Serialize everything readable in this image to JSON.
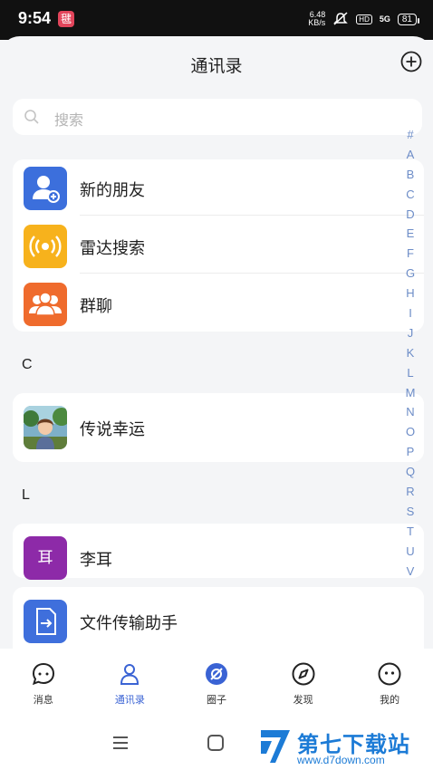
{
  "status_bar": {
    "time": "9:54",
    "app_badge": "毽",
    "net_speed_value": "6.48",
    "net_speed_unit": "KB/s",
    "signal_label": "5G",
    "hd_label": "HD",
    "battery": "81"
  },
  "header": {
    "title": "通讯录"
  },
  "search": {
    "placeholder": "搜索"
  },
  "top_items": [
    {
      "label": "新的朋友",
      "color": "#3c6fdc",
      "icon": "add-friend-icon"
    },
    {
      "label": "雷达搜索",
      "color": "#f7b21c",
      "icon": "radar-icon"
    },
    {
      "label": "群聊",
      "color": "#ef6b2d",
      "icon": "group-chat-icon"
    }
  ],
  "sections": [
    {
      "letter": "C",
      "contacts": [
        {
          "name": "传说幸运",
          "avatar": "photo"
        }
      ]
    },
    {
      "letter": "L",
      "contacts": [
        {
          "name": "李耳",
          "avatar_text": "耳",
          "color": "#8d2aa8"
        }
      ]
    }
  ],
  "file_helper": {
    "name": "文件传输助手",
    "color": "#3f6fdc",
    "icon": "file-transfer-icon"
  },
  "alpha_index": [
    "#",
    "A",
    "B",
    "C",
    "D",
    "E",
    "F",
    "G",
    "H",
    "I",
    "J",
    "K",
    "L",
    "M",
    "N",
    "O",
    "P",
    "Q",
    "R",
    "S",
    "T",
    "U",
    "V"
  ],
  "tabs": [
    {
      "label": "消息",
      "icon": "message-icon",
      "active": false
    },
    {
      "label": "通讯录",
      "icon": "contacts-icon",
      "active": true
    },
    {
      "label": "圈子",
      "icon": "moments-icon",
      "active": false
    },
    {
      "label": "发现",
      "icon": "compass-icon",
      "active": false
    },
    {
      "label": "我的",
      "icon": "profile-icon",
      "active": false
    }
  ],
  "watermark": {
    "title": "第七下载站",
    "url": "www.d7down.com"
  },
  "colors": {
    "accent": "#3a63d4",
    "index": "#6c8cc7"
  }
}
